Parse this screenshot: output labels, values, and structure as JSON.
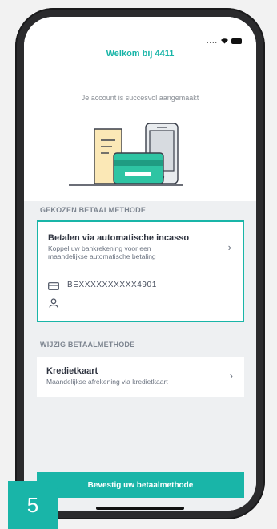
{
  "header": {
    "title": "Welkom bij 4411",
    "subtitle": "Je account is succesvol aangemaakt"
  },
  "sections": {
    "chosen_label": "GEKOZEN BETAALMETHODE",
    "change_label": "WIJZIG BETAALMETHODE"
  },
  "chosen_method": {
    "title": "Betalen via automatische incasso",
    "description_line1": "Koppel uw bankrekening voor een",
    "description_line2": "maandelijkse automatische betaling",
    "iban": "BEXXXXXXXXXX4901"
  },
  "alt_method": {
    "title": "Kredietkaart",
    "description": "Maandelijkse afrekening via kredietkaart"
  },
  "confirm_button": "Bevestig uw betaalmethode",
  "step_badge": "5",
  "chevron": "›",
  "colors": {
    "accent": "#19b5a8",
    "background": "#eef0f2",
    "text": "#2f3440"
  }
}
